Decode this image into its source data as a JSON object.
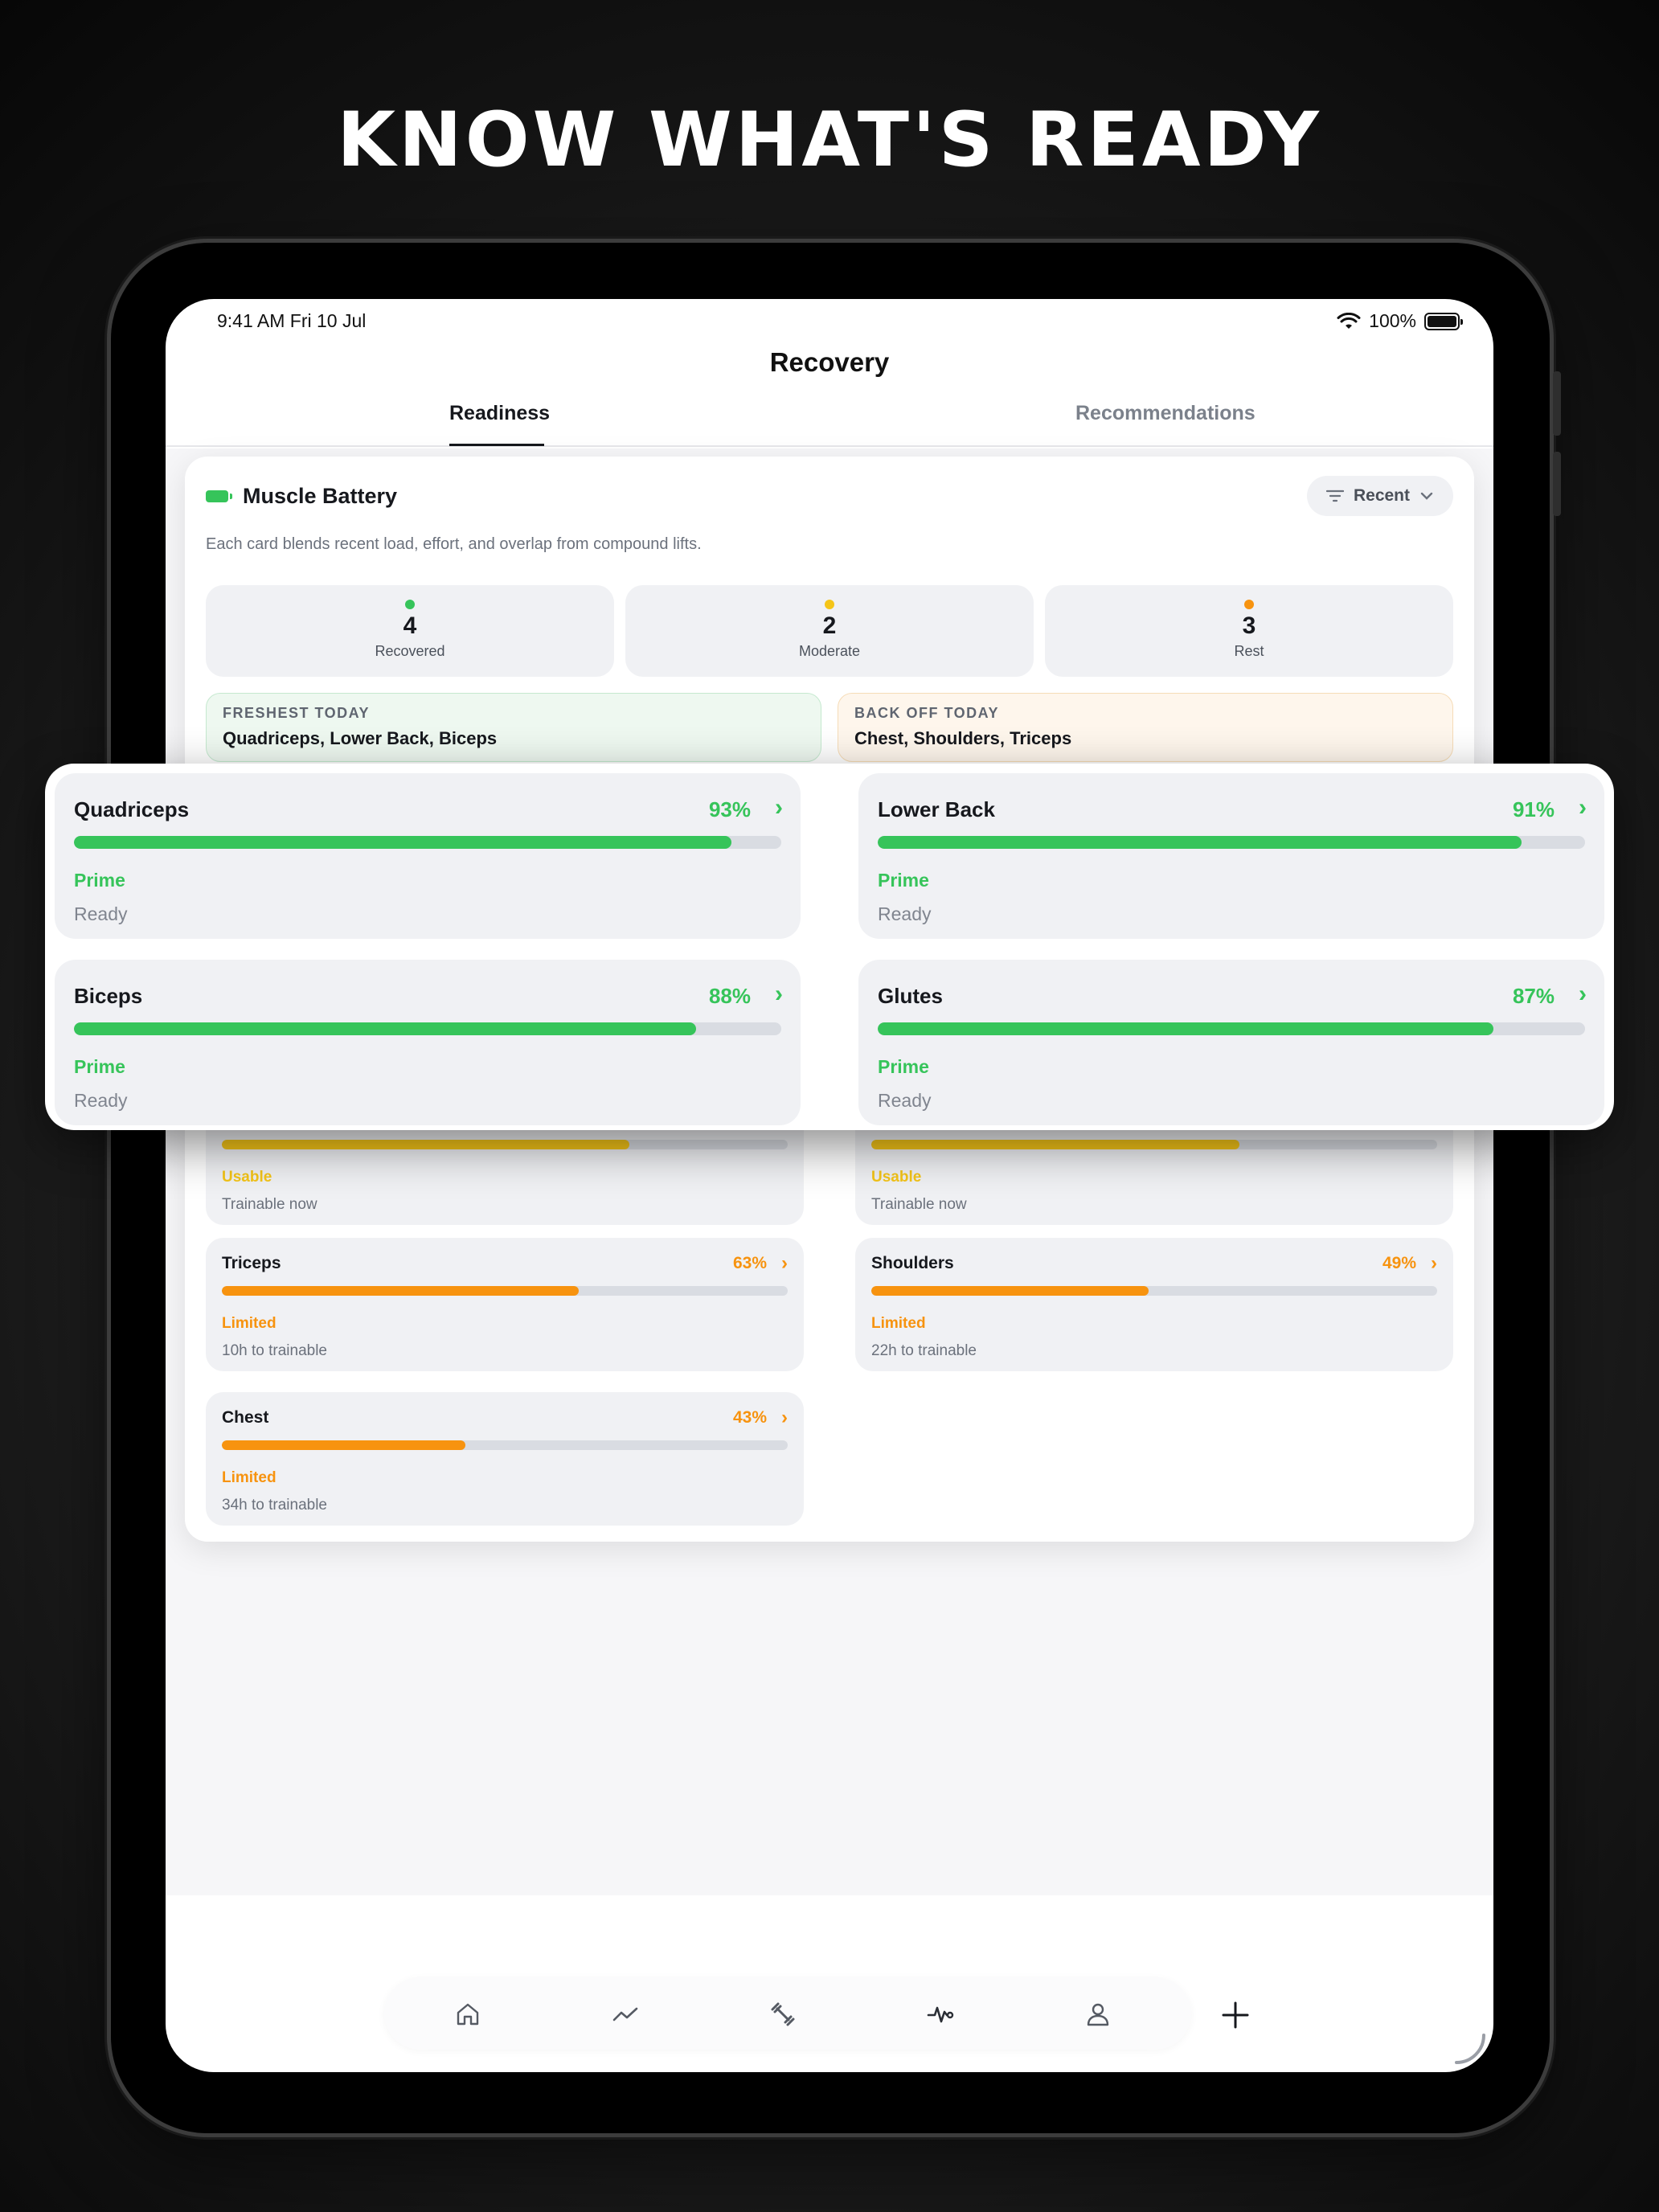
{
  "headline": "KNOW WHAT'S READY",
  "status_bar": {
    "time": "9:41 AM Fri 10 Jul",
    "battery": "100%"
  },
  "nav_title": "Recovery",
  "tabs": [
    {
      "label": "Readiness",
      "active": true
    },
    {
      "label": "Recommendations",
      "active": false
    }
  ],
  "muscle_battery": {
    "title": "Muscle Battery",
    "filter_label": "Recent",
    "subtitle": "Each card blends recent load, effort, and overlap from compound lifts.",
    "stats": [
      {
        "count": "4",
        "label": "Recovered",
        "color": "#36c45a"
      },
      {
        "count": "2",
        "label": "Moderate",
        "color": "#f5c518"
      },
      {
        "count": "3",
        "label": "Rest",
        "color": "#f7930f"
      }
    ],
    "freshest": {
      "kicker": "FRESHEST TODAY",
      "text": "Quadriceps, Lower Back, Biceps"
    },
    "back_off": {
      "kicker": "BACK OFF TODAY",
      "text": "Chest, Shoulders, Triceps"
    }
  },
  "featured_muscles": [
    {
      "name": "Quadriceps",
      "percent": "93%",
      "level": 0.93,
      "status": "Prime",
      "detail": "Ready"
    },
    {
      "name": "Lower Back",
      "percent": "91%",
      "level": 0.91,
      "status": "Prime",
      "detail": "Ready"
    },
    {
      "name": "Biceps",
      "percent": "88%",
      "level": 0.88,
      "status": "Prime",
      "detail": "Ready"
    },
    {
      "name": "Glutes",
      "percent": "87%",
      "level": 0.87,
      "status": "Prime",
      "detail": "Ready"
    }
  ],
  "muscles": [
    {
      "name": "",
      "percent": "",
      "level": 0.72,
      "status": "Usable",
      "detail": "Trainable now",
      "color": "#f5c518"
    },
    {
      "name": "",
      "percent": "",
      "level": 0.65,
      "status": "Usable",
      "detail": "Trainable now",
      "color": "#f5c518"
    },
    {
      "name": "Triceps",
      "percent": "63%",
      "level": 0.63,
      "status": "Limited",
      "detail": "10h to trainable",
      "color": "#f7930f"
    },
    {
      "name": "Shoulders",
      "percent": "49%",
      "level": 0.49,
      "status": "Limited",
      "detail": "22h to trainable",
      "color": "#f7930f"
    },
    {
      "name": "Chest",
      "percent": "43%",
      "level": 0.43,
      "status": "Limited",
      "detail": "34h to trainable",
      "color": "#f7930f"
    }
  ],
  "tab_bar": [
    "home-icon",
    "trend-icon",
    "dumbbell-icon",
    "heartbeat-icon",
    "profile-icon",
    "plus-icon"
  ],
  "colors": {
    "prime": "#36c45a",
    "usable": "#f5c518",
    "limited": "#f7930f"
  }
}
